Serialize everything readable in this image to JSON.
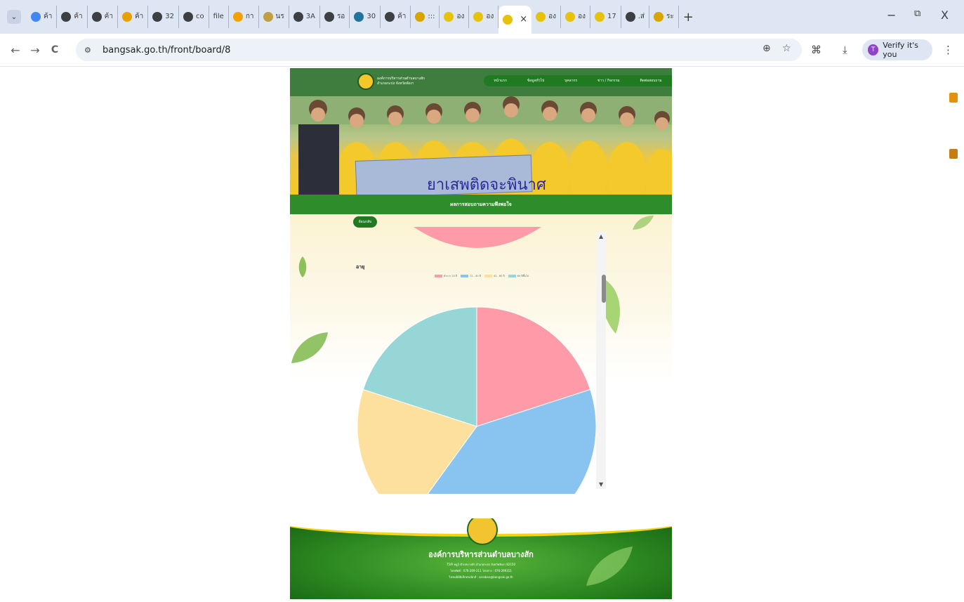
{
  "browser": {
    "tabs": [
      {
        "label": "ค้า",
        "favicon_color": "#4285f4",
        "icon": "google-icon"
      },
      {
        "label": "ค้า",
        "favicon_color": "#3c4043",
        "icon": "globe-icon"
      },
      {
        "label": "ค้า",
        "favicon_color": "#3c4043",
        "icon": "globe-icon"
      },
      {
        "label": "ค้า",
        "favicon_color": "#e6a100",
        "icon": "site-icon"
      },
      {
        "label": "32",
        "favicon_color": "#3c4043",
        "icon": "globe-icon"
      },
      {
        "label": "co",
        "favicon_color": "#3c4043",
        "icon": "globe-icon"
      },
      {
        "label": "file",
        "favicon_color": "#ffffff",
        "icon": "file-icon"
      },
      {
        "label": "กา",
        "favicon_color": "#f1a200",
        "icon": "site-icon"
      },
      {
        "label": "นร",
        "favicon_color": "#c0a040",
        "icon": "site-icon"
      },
      {
        "label": "3A",
        "favicon_color": "#3c4043",
        "icon": "globe-icon"
      },
      {
        "label": "รอ",
        "favicon_color": "#3c4043",
        "icon": "globe-icon"
      },
      {
        "label": "30",
        "favicon_color": "#21759b",
        "icon": "wordpress-icon"
      },
      {
        "label": "ค้า",
        "favicon_color": "#3c4043",
        "icon": "globe-icon"
      },
      {
        "label": ":::",
        "favicon_color": "#d9a400",
        "icon": "site-icon"
      },
      {
        "label": "อง",
        "favicon_color": "#e8c10a",
        "icon": "site-icon"
      },
      {
        "label": "อง",
        "favicon_color": "#e8c10a",
        "icon": "site-icon"
      },
      {
        "label": "",
        "favicon_color": "#e8c10a",
        "icon": "site-icon",
        "active": true
      },
      {
        "label": "อง",
        "favicon_color": "#e8c10a",
        "icon": "site-icon"
      },
      {
        "label": "อง",
        "favicon_color": "#e8c10a",
        "icon": "site-icon"
      },
      {
        "label": "17",
        "favicon_color": "#e8c10a",
        "icon": "site-icon"
      },
      {
        "label": ".ส่",
        "favicon_color": "#3c4043",
        "icon": "globe-icon"
      },
      {
        "label": "ระ",
        "favicon_color": "#d9a400",
        "icon": "site-icon"
      }
    ],
    "new_tab": "+",
    "url": "bangsak.go.th/front/board/8",
    "verify_label": "Verify it's you",
    "verify_initial": "T",
    "minimize": "−",
    "restore": "⧉",
    "close": "X",
    "back": "←",
    "forward": "→",
    "reload": "C",
    "zoom_icon": "⊕",
    "star_icon": "☆",
    "ext_icon": "⌘",
    "download_icon": "⤓",
    "menu_icon": "⋮",
    "tab_search": "⌄",
    "tab_close": "×",
    "site_info": "⚙"
  },
  "site": {
    "org_small": "องค์การบริหารส่วนตำบลบางสัก",
    "org_sub": "อำเภอกะปง จังหวัดพังงา",
    "nav": [
      "หน้าแรก",
      "ข้อมูลทั่วไป",
      "บุคลากร",
      "ข่าว / กิจกรรม",
      "ติดต่อสอบถาม"
    ],
    "banner_text": "ยาเสพติดจะพินาศ",
    "page_title": "ผลการสอบถามความพึงพอใจ",
    "back_button": "ย้อนกลับ",
    "chart_heading": "อายุ",
    "footer": {
      "title": "องค์การบริหารส่วนตำบลบางสัก",
      "address": "75/9 หมู่3 ตำบลบางสัก อำเภอกะปง จังหวัดพังงา 82150",
      "phone": "โทรศัพท์ : 076-269-311 โทรสาร : 076-269311",
      "email": "ไปรษณีย์อิเล็กทรอนิกส์ : saraban@bangsak.go.th"
    }
  },
  "chart_data": {
    "type": "pie",
    "title": "อายุ",
    "categories": [
      "ต่ำกว่า 20 ปี",
      "21 - 40 ปี",
      "41 - 60 ปี",
      "60 ปีขึ้นไป"
    ],
    "values": [
      20,
      40,
      20,
      20
    ],
    "colors": [
      "#ff9aa8",
      "#88c4ef",
      "#fde09d",
      "#97d6d6"
    ],
    "legend_position": "top"
  }
}
